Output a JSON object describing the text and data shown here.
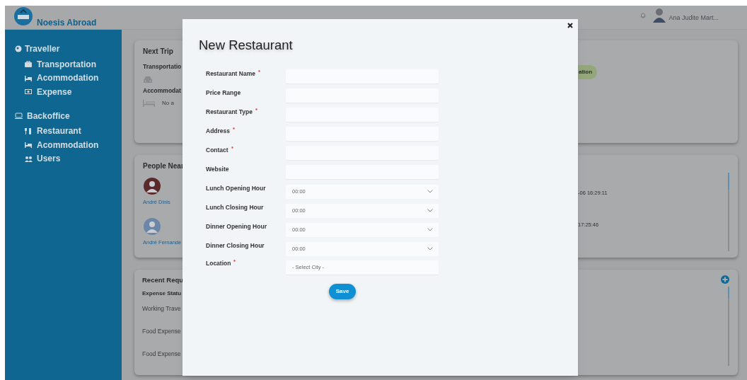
{
  "header": {
    "brand": "Noesis Abroad",
    "user_name": "Ana Judite Mart..."
  },
  "sidebar": {
    "sections": [
      {
        "title": "Traveller",
        "items": [
          {
            "label": "Transportation"
          },
          {
            "label": "Acommodation"
          },
          {
            "label": "Expense"
          }
        ]
      },
      {
        "title": "Backoffice",
        "items": [
          {
            "label": "Restaurant"
          },
          {
            "label": "Acommodation"
          },
          {
            "label": "Users"
          }
        ]
      }
    ]
  },
  "next_trip": {
    "title": "Next Trip",
    "transportation_label": "Transportatio",
    "accommodation_label": "Accommodat",
    "accommodation_text": "No a",
    "status_badge": "ation"
  },
  "people_near": {
    "title": "People Near",
    "people": [
      {
        "name": "André Dinis"
      },
      {
        "name": "André Fernande"
      }
    ],
    "times": [
      "-06 16:29:11",
      "17:25:46"
    ]
  },
  "recent_requests": {
    "title": "Recent Requ",
    "column_label": "Expense Statu",
    "rows": [
      "Working Trave",
      "Food Expense",
      "Food Expense"
    ]
  },
  "modal": {
    "title": "New Restaurant",
    "fields": [
      {
        "label": "Restaurant Name",
        "required": true,
        "kind": "text"
      },
      {
        "label": "Price Range",
        "required": false,
        "kind": "text"
      },
      {
        "label": "Restaurant Type",
        "required": true,
        "kind": "text"
      },
      {
        "label": "Address",
        "required": true,
        "kind": "text"
      },
      {
        "label": "Contact",
        "required": true,
        "kind": "text"
      },
      {
        "label": "Website",
        "required": false,
        "kind": "text"
      },
      {
        "label": "Lunch Opening Hour",
        "required": false,
        "kind": "select",
        "value": "00:00"
      },
      {
        "label": "Lunch Closing Hour",
        "required": false,
        "kind": "select",
        "value": "00:00"
      },
      {
        "label": "Dinner Opening Hour",
        "required": false,
        "kind": "select",
        "value": "00:00"
      },
      {
        "label": "Dinner Closing Hour",
        "required": false,
        "kind": "select",
        "value": "00:00"
      },
      {
        "label": "Location",
        "required": true,
        "kind": "city",
        "value": "- Select City -"
      }
    ],
    "save": "Save"
  }
}
